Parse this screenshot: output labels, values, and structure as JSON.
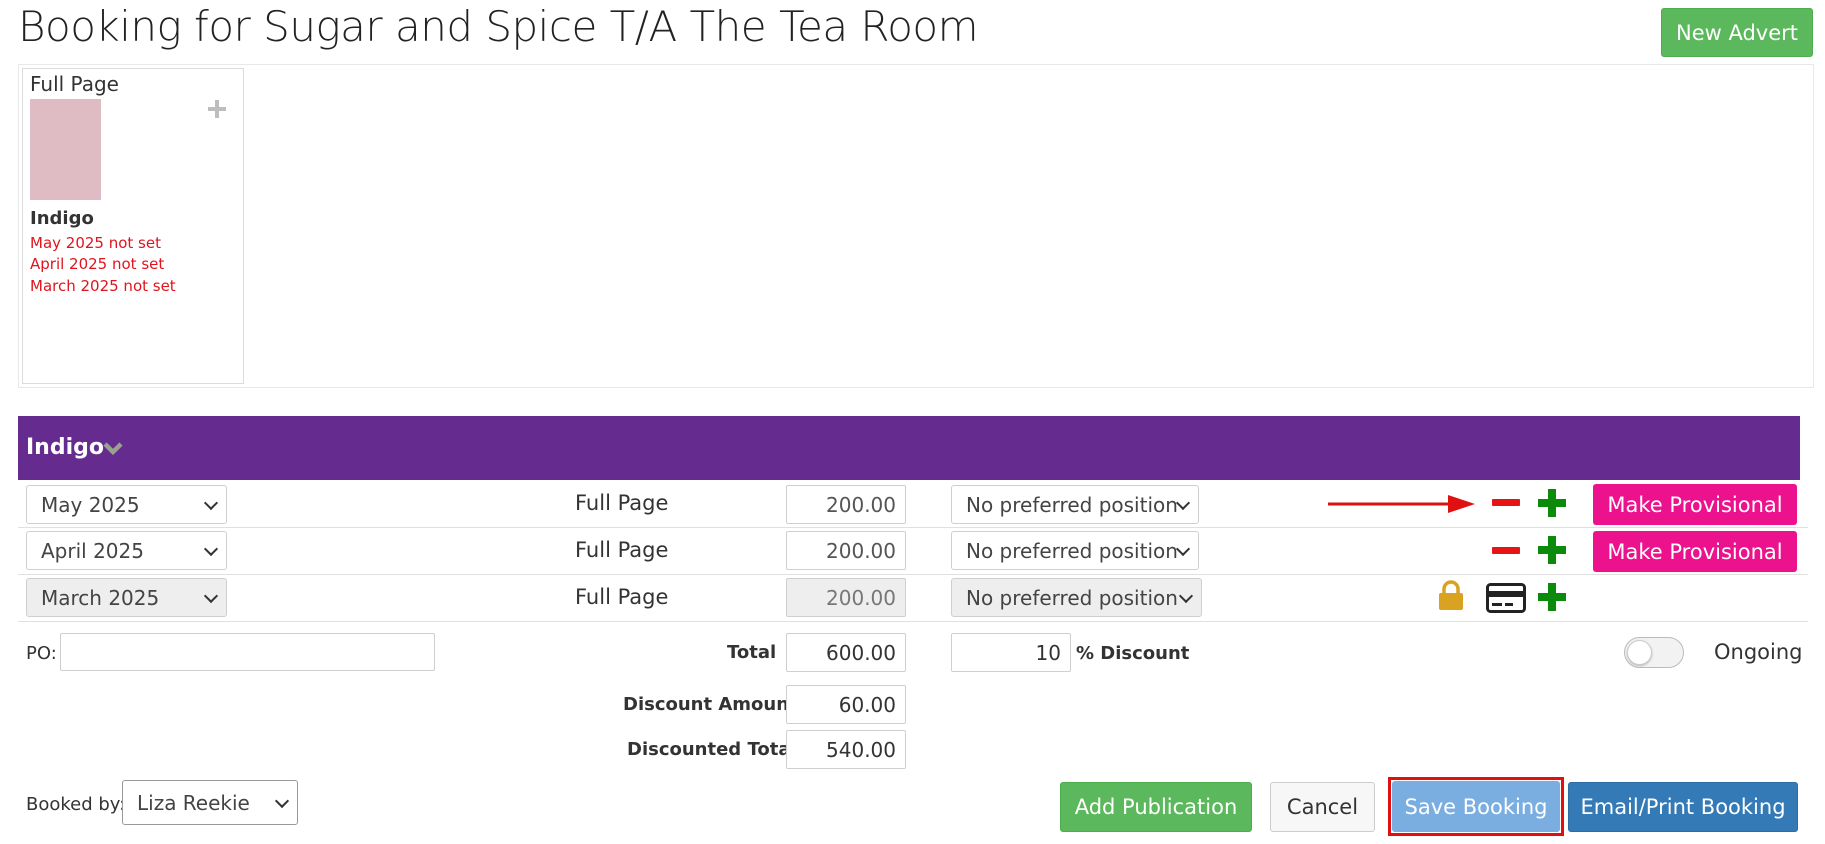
{
  "page": {
    "title": "Booking for Sugar and Spice T/A The Tea Room"
  },
  "header": {
    "new_advert_label": "New Advert"
  },
  "advert_card": {
    "size": "Full Page",
    "publication": "Indigo",
    "status_lines": [
      "May 2025 not set",
      "April 2025 not set",
      "March 2025 not set"
    ]
  },
  "publication": {
    "name": "Indigo"
  },
  "rows": [
    {
      "month": "May 2025",
      "size": "Full Page",
      "price": "200.00",
      "position": "No preferred position",
      "action_label": "Make Provisional"
    },
    {
      "month": "April 2025",
      "size": "Full Page",
      "price": "200.00",
      "position": "No preferred position",
      "action_label": "Make Provisional"
    },
    {
      "month": "March 2025",
      "size": "Full Page",
      "price": "200.00",
      "position": "No preferred position"
    }
  ],
  "totals": {
    "po_label": "PO:",
    "po_value": "",
    "total_label": "Total",
    "total_value": "600.00",
    "discount_percent": "10",
    "discount_label": "% Discount",
    "ongoing_label": "Ongoing",
    "discount_amount_label": "Discount Amount",
    "discount_amount_value": "60.00",
    "discounted_total_label": "Discounted Total",
    "discounted_total_value": "540.00"
  },
  "footer": {
    "booked_by_label": "Booked by:",
    "booked_by_value": "Liza Reekie",
    "add_publication_label": "Add Publication",
    "cancel_label": "Cancel",
    "save_booking_label": "Save Booking",
    "email_print_label": "Email/Print Booking"
  },
  "colors": {
    "publication_bar": "#652b8e",
    "provisional": "#ec118c",
    "add_green": "#0c8a0c",
    "remove_red": "#e51515",
    "not_set_red": "#e0141e",
    "lock_gold": "#d9a321"
  }
}
